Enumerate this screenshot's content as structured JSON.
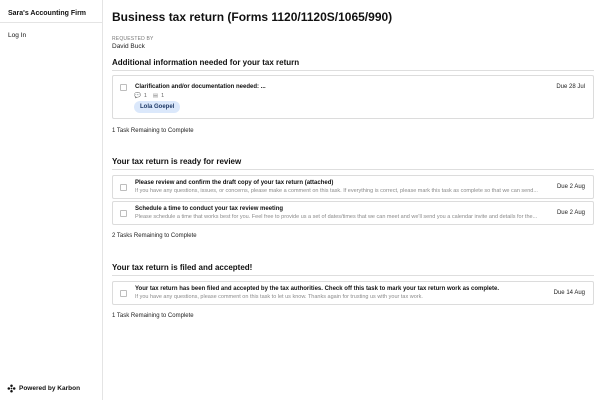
{
  "sidebar": {
    "firm_name": "Sara's Accounting Firm",
    "login_label": "Log In",
    "powered_by": "Powered by Karbon",
    "logo_icon": "karbon-logo-icon"
  },
  "page": {
    "title": "Business tax return (Forms 1120/1120S/1065/990)",
    "requested_by_label": "REQUESTED BY",
    "requested_by_name": "David Buck"
  },
  "sections": [
    {
      "title": "Additional information needed for your tax return",
      "tasks": [
        {
          "title": "Clarification and/or documentation needed: ...",
          "due": "Due 28 Jul",
          "comment_count": "1",
          "attachment_count": "1",
          "comment_icon": "comment-icon",
          "attachment_icon": "attachment-icon",
          "assignee": "Lola Goepel"
        }
      ],
      "remaining": "1 Task Remaining to Complete"
    },
    {
      "title": "Your tax return is ready for review",
      "tasks": [
        {
          "title": "Please review and confirm the draft copy of your tax return (attached)",
          "desc": "If you have any questions, issues, or concerns, please make a comment on this task. If everything is correct, please mark this task as complete so that we can send...",
          "due": "Due 2 Aug"
        },
        {
          "title": "Schedule a time to conduct your tax review meeting",
          "desc": "Please schedule a time that works best for you. Feel free to provide us a set of dates/times that we can meet and we'll send you a calendar invite and details for the...",
          "due": "Due 2 Aug"
        }
      ],
      "remaining": "2 Tasks Remaining to Complete"
    },
    {
      "title": "Your tax return is filed and accepted!",
      "tasks": [
        {
          "title": "Your tax return has been filed and accepted by the tax authorities. Check off this task to mark your tax return work as complete.",
          "desc": "If you have any questions, please comment on this task to let us know. Thanks again for trusting us with your tax work.",
          "due": "Due 14 Aug"
        }
      ],
      "remaining": "1 Task Remaining to Complete"
    }
  ]
}
